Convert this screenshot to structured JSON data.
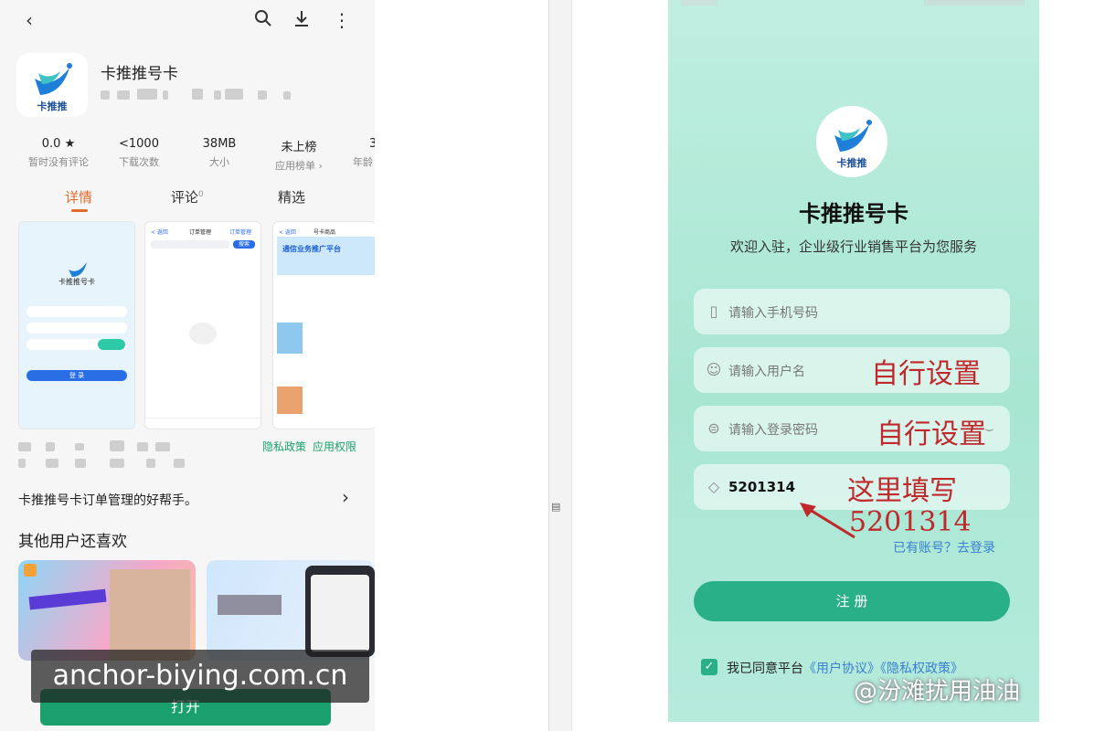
{
  "store": {
    "app_name": "卡推推号卡",
    "logo_text": "卡推推",
    "stats": [
      {
        "value": "0.0 ★",
        "label": "暂时没有评论"
      },
      {
        "value": "<1000",
        "label": "下载次数"
      },
      {
        "value": "38MB",
        "label": "大小"
      },
      {
        "value": "未上榜",
        "label": "应用榜单 ›"
      },
      {
        "value": "3",
        "label": "年龄"
      }
    ],
    "tabs": [
      "详情",
      "评论",
      "精选"
    ],
    "tab_comment_count": "0",
    "shot1": {
      "title": "卡推推号卡",
      "btn": "登 录"
    },
    "shot2": {
      "back": "< 返回",
      "title": "订单管理",
      "action": "订单管理",
      "search": "搜索"
    },
    "shot3": {
      "back": "< 返回",
      "title": "号卡商品",
      "banner": "通信业务推广平台"
    },
    "links": {
      "privacy": "隐私政策",
      "permissions": "应用权限"
    },
    "description": "卡推推号卡订单管理的好帮手。",
    "section_title": "其他用户还喜欢",
    "open_label": "打开",
    "watermark": "anchor-biying.com.cn"
  },
  "phone": {
    "logo_text": "卡推推",
    "title": "卡推推号卡",
    "subtitle": "欢迎入驻，企业级行业销售平台为您服务",
    "phone_placeholder": "请输入手机号码",
    "username_placeholder": "请输入用户名",
    "password_placeholder": "请输入登录密码",
    "invite_value": "5201314",
    "annot_user": "自行设置",
    "annot_pass": "自行设置",
    "annot_invite_1": "这里填写",
    "annot_invite_2": "5201314",
    "have_account": "已有账号？去登录",
    "register_label": "注 册",
    "agree_prefix": "我已同意平台",
    "agreement_user": "《用户协议》",
    "agreement_privacy": "《隐私权政策》",
    "brand_overlay": "@汾滩扰用油油"
  },
  "colors": {
    "accent": "#1aa06d",
    "annotation": "#c0282c",
    "phone_bg": "#b3ead9"
  }
}
